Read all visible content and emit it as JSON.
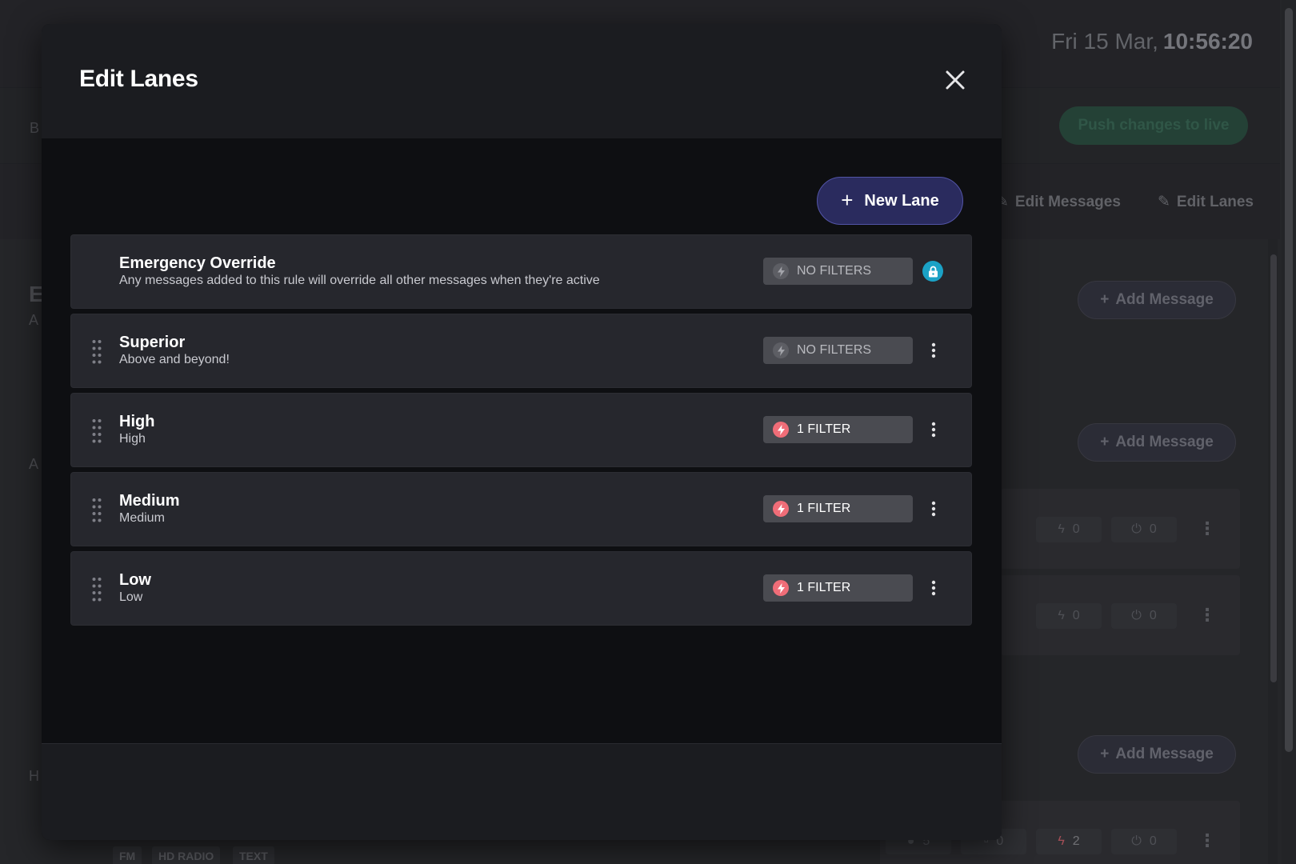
{
  "background": {
    "clock": {
      "date": "Fri 15 Mar,",
      "time": "10:56:20"
    },
    "push_button_label": "Push changes to live",
    "tabs": [
      {
        "label": "Edit Messages",
        "icon": "pencil-icon"
      },
      {
        "label": "Edit Lanes",
        "icon": "pencil-icon"
      }
    ],
    "add_message_label": "Add Message",
    "chip_counts": [
      "0",
      "0",
      "0",
      "0",
      "5",
      "0",
      "2",
      "0"
    ],
    "bottom_tags": [
      "FM",
      "HD RADIO",
      "TEXT"
    ],
    "left_letters": [
      "B",
      "E",
      "A",
      "A",
      "H"
    ]
  },
  "modal": {
    "title": "Edit Lanes",
    "new_lane_label": "New Lane",
    "lanes": [
      {
        "name": "Emergency Override",
        "description": "Any messages added to this rule will override all other messages when they're active",
        "filter_label": "NO FILTERS",
        "filter_state": "none",
        "locked": true
      },
      {
        "name": "Superior",
        "description": "Above and beyond!",
        "filter_label": "NO FILTERS",
        "filter_state": "none",
        "locked": false
      },
      {
        "name": "High",
        "description": "High",
        "filter_label": "1 FILTER",
        "filter_state": "active",
        "locked": false
      },
      {
        "name": "Medium",
        "description": "Medium",
        "filter_label": "1 FILTER",
        "filter_state": "active",
        "locked": false
      },
      {
        "name": "Low",
        "description": "Low",
        "filter_label": "1 FILTER",
        "filter_state": "active",
        "locked": false
      }
    ]
  },
  "colors": {
    "primary_button": "#2a2b5e",
    "filter_active": "#f06d78",
    "lock_badge": "#1ba2c6",
    "push_button": "#2d5a48"
  }
}
